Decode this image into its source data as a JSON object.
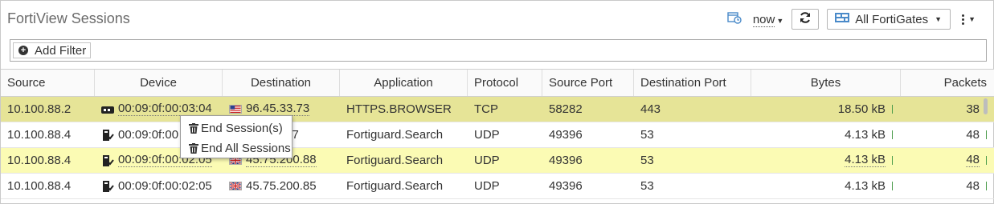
{
  "header": {
    "title": "FortiView Sessions",
    "time_label": "now",
    "fortigate_label": "All FortiGates",
    "icons": {
      "time": "clock-calendar-icon",
      "refresh": "refresh-icon",
      "fortigate": "fortigate-device-icon",
      "more": "vertical-dots-icon"
    }
  },
  "filter": {
    "add_label": "Add Filter"
  },
  "table": {
    "columns": [
      "Source",
      "Device",
      "Destination",
      "Application",
      "Protocol",
      "Source Port",
      "Destination Port",
      "Bytes",
      "Packets"
    ],
    "rows": [
      {
        "source": "10.100.88.2",
        "device": "00:09:0f:00:03:04",
        "device_icon": "fortigate-device-icon",
        "destination": "96.45.33.73",
        "flag": "us",
        "application": "HTTPS.BROWSER",
        "protocol": "TCP",
        "source_port": "58282",
        "dest_port": "443",
        "bytes": "18.50 kB",
        "packets": "38"
      },
      {
        "source": "10.100.88.4",
        "device": "00:09:0f:00",
        "device_icon": "server-device-icon",
        "destination": ".87",
        "flag": "",
        "application": "Fortiguard.Search",
        "protocol": "UDP",
        "source_port": "49396",
        "dest_port": "53",
        "bytes": "4.13 kB",
        "packets": "48"
      },
      {
        "source": "10.100.88.4",
        "device": "00:09:0f:00:02:05",
        "device_icon": "server-device-icon",
        "destination": "45.75.200.88",
        "flag": "uk",
        "application": "Fortiguard.Search",
        "protocol": "UDP",
        "source_port": "49396",
        "dest_port": "53",
        "bytes": "4.13 kB",
        "packets": "48"
      },
      {
        "source": "10.100.88.4",
        "device": "00:09:0f:00:02:05",
        "device_icon": "server-device-icon",
        "destination": "45.75.200.85",
        "flag": "uk",
        "application": "Fortiguard.Search",
        "protocol": "UDP",
        "source_port": "49396",
        "dest_port": "53",
        "bytes": "4.13 kB",
        "packets": "48"
      }
    ]
  },
  "context_menu": {
    "items": [
      {
        "label": "End Session(s)",
        "icon": "trash-icon"
      },
      {
        "label": "End All Sessions",
        "icon": "trash-icon"
      }
    ]
  },
  "colors": {
    "selected_row": "#e6e497",
    "hover_row": "#fbfbb4",
    "bar": "#4a9c4a"
  }
}
